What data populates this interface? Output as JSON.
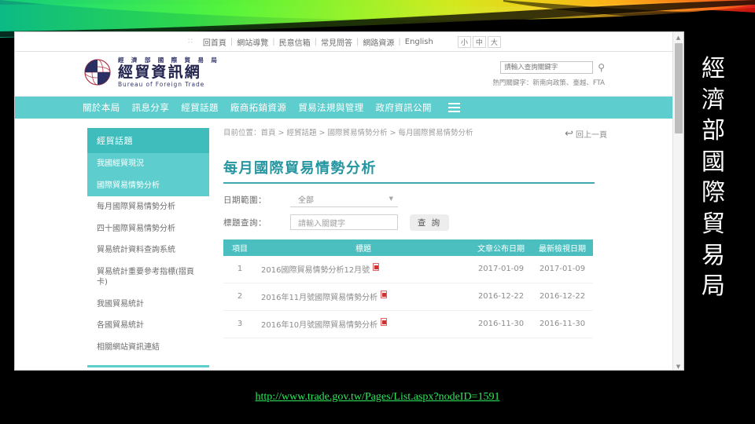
{
  "slide": {
    "vertical_title_chars": [
      "經",
      "濟",
      "部",
      "國",
      "際",
      "貿",
      "易",
      "局"
    ],
    "caption_url": "http://www.trade.gov.tw/Pages/List.aspx?nodeID=1591",
    "background_color": "#000000",
    "ribbon_colors": [
      "#0fa07a",
      "#23c552",
      "#7ee534",
      "#c9e218",
      "#f5b400",
      "#e86b00",
      "#c41010"
    ]
  },
  "site": {
    "utility_nav": {
      "dots": "∷",
      "links": [
        "回首頁",
        "網站導覽",
        "民意信箱",
        "常見問答",
        "網路資源",
        "English"
      ],
      "separator": "|",
      "font_sizes": [
        "小",
        "中",
        "大"
      ]
    },
    "logo": {
      "top_line": "經 濟 部 國 際 貿 易 局",
      "main_line": "經貿資訊網",
      "english": "Bureau of Foreign Trade",
      "icon": "globe-icon"
    },
    "search": {
      "placeholder": "請輸入查詢關鍵字",
      "value": "",
      "icon": "search-icon",
      "hot_keywords_label": "熱門關鍵字：",
      "hot_keywords": "新南向政策、臺越、FTA"
    },
    "main_nav": {
      "items": [
        "關於本局",
        "訊息分享",
        "經貿話題",
        "廠商拓銷資源",
        "貿易法規與管理",
        "政府資訊公開"
      ],
      "menu_icon": "hamburger-menu-icon",
      "background": "#5ecdcd"
    }
  },
  "sidebar": {
    "heading": "經貿話題",
    "items": [
      {
        "label": "我國經貿現況",
        "active": true
      },
      {
        "label": "國際貿易情勢分析",
        "active": true
      },
      {
        "label": "每月國際貿易情勢分析",
        "active": false
      },
      {
        "label": "四十國際貿易情勢分析",
        "active": false
      },
      {
        "label": "貿易統計資料查詢系統",
        "active": false
      },
      {
        "label": "貿易統計重要參考指標(摺頁卡)",
        "active": false
      },
      {
        "label": "我國貿易統計",
        "active": false
      },
      {
        "label": "各國貿易統計",
        "active": false
      },
      {
        "label": "相關網站資訊連結",
        "active": false
      }
    ]
  },
  "main": {
    "breadcrumb": "目前位置：首頁 > 經貿話題 > 國際貿易情勢分析 > 每月國際貿易情勢分析",
    "back_link": "回上一頁",
    "back_icon": "back-arrow-icon",
    "page_title": "每月國際貿易情勢分析",
    "form": {
      "date_range_label": "日期範圍：",
      "date_range_value": "全部",
      "date_range_caret": "▼",
      "title_search_label": "標題查詢：",
      "title_search_placeholder": "請輸入關鍵字",
      "title_search_value": "",
      "submit_label": "查 詢"
    },
    "table": {
      "headers": [
        "項目",
        "標題",
        "文章公布日期",
        "最新檢視日期"
      ],
      "rows": [
        {
          "index": "1",
          "title": "2016國際貿易情勢分析12月號",
          "attachment": "pdf-icon",
          "published": "2017-01-09",
          "reviewed": "2017-01-09"
        },
        {
          "index": "2",
          "title": "2016年11月號國際貿易情勢分析",
          "attachment": "pdf-icon",
          "published": "2016-12-22",
          "reviewed": "2016-12-22"
        },
        {
          "index": "3",
          "title": "2016年10月號國際貿易情勢分析",
          "attachment": "pdf-icon",
          "published": "2016-11-30",
          "reviewed": "2016-11-30"
        }
      ]
    }
  },
  "scrollbar": {
    "up": "▲",
    "down": "▼"
  }
}
